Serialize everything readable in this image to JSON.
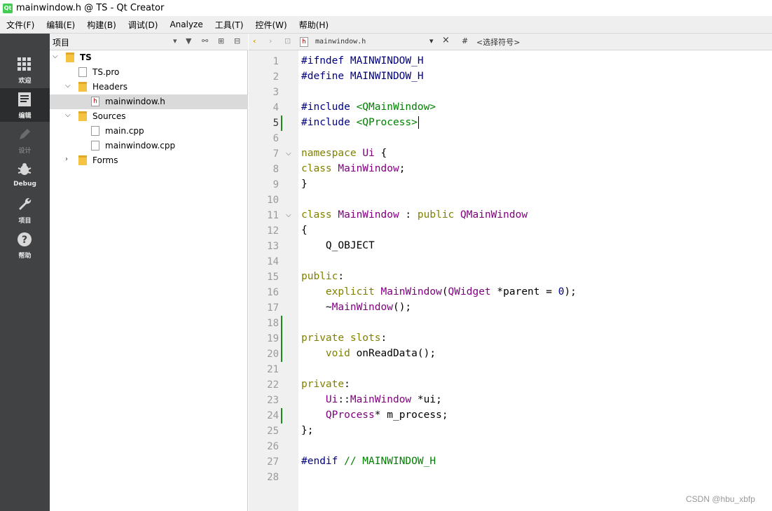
{
  "window": {
    "title": "mainwindow.h @ TS - Qt Creator",
    "app_icon": "qt-icon"
  },
  "menu": [
    "文件(F)",
    "编辑(E)",
    "构建(B)",
    "调试(D)",
    "Analyze",
    "工具(T)",
    "控件(W)",
    "帮助(H)"
  ],
  "modes": [
    {
      "label": "欢迎",
      "icon": "grid-icon"
    },
    {
      "label": "编辑",
      "icon": "document-icon"
    },
    {
      "label": "设计",
      "icon": "pencil-icon"
    },
    {
      "label": "Debug",
      "icon": "bug-icon"
    },
    {
      "label": "项目",
      "icon": "wrench-icon"
    },
    {
      "label": "帮助",
      "icon": "help-icon"
    }
  ],
  "project_panel": {
    "title": "项目",
    "tree": [
      {
        "label": "TS"
      },
      {
        "label": "TS.pro"
      },
      {
        "label": "Headers"
      },
      {
        "label": "mainwindow.h"
      },
      {
        "label": "Sources"
      },
      {
        "label": "main.cpp"
      },
      {
        "label": "mainwindow.cpp"
      },
      {
        "label": "Forms"
      }
    ]
  },
  "editor": {
    "file_name": "mainwindow.h",
    "symbol_placeholder": "<选择符号>",
    "symbol_hash": "#",
    "current_line": 5,
    "line_numbers": [
      "1",
      "2",
      "3",
      "4",
      "5",
      "6",
      "7",
      "8",
      "9",
      "10",
      "11",
      "12",
      "13",
      "14",
      "15",
      "16",
      "17",
      "18",
      "19",
      "20",
      "21",
      "22",
      "23",
      "24",
      "25",
      "26",
      "27",
      "28"
    ],
    "lines": [
      "#ifndef MAINWINDOW_H",
      "#define MAINWINDOW_H",
      "",
      "#include <QMainWindow>",
      "#include <QProcess>",
      "",
      "namespace Ui {",
      "class MainWindow;",
      "}",
      "",
      "class MainWindow : public QMainWindow",
      "{",
      "    Q_OBJECT",
      "",
      "public:",
      "    explicit MainWindow(QWidget *parent = 0);",
      "    ~MainWindow();",
      "",
      "private slots:",
      "    void onReadData();",
      "",
      "private:",
      "    Ui::MainWindow *ui;",
      "    QProcess* m_process;",
      "};",
      "",
      "#endif // MAINWINDOW_H",
      ""
    ]
  },
  "watermark": "CSDN @hbu_xbfp"
}
